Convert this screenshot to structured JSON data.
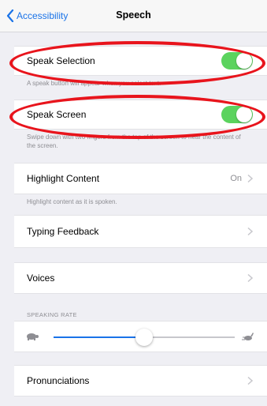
{
  "nav": {
    "back_label": "Accessibility",
    "title": "Speech"
  },
  "speak_selection": {
    "label": "Speak Selection",
    "enabled": true,
    "footnote": "A speak button will appear when you select text."
  },
  "speak_screen": {
    "label": "Speak Screen",
    "enabled": true,
    "footnote": "Swipe down with two fingers from the top of the screen to hear the content of the screen."
  },
  "highlight_content": {
    "label": "Highlight Content",
    "value": "On",
    "footnote": "Highlight content as it is spoken."
  },
  "typing_feedback": {
    "label": "Typing Feedback"
  },
  "voices": {
    "label": "Voices"
  },
  "speaking_rate": {
    "header": "SPEAKING RATE",
    "slow_icon": "turtle-icon",
    "fast_icon": "hare-icon",
    "level": 0.5
  },
  "pronunciations": {
    "label": "Pronunciations"
  },
  "colors": {
    "accent": "#1a73e8",
    "toggle_on": "#5bd35e",
    "annotation": "#e8141c"
  }
}
